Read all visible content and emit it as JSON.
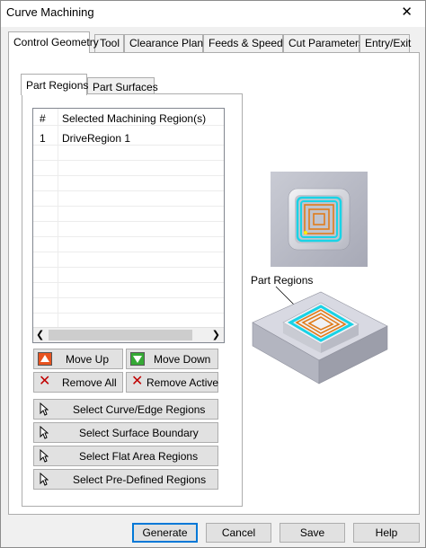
{
  "window": {
    "title": "Curve Machining",
    "close_symbol": "✕"
  },
  "tabs": [
    {
      "label": "Control Geometry",
      "active": true
    },
    {
      "label": "Tool",
      "active": false
    },
    {
      "label": "Clearance Plane",
      "active": false
    },
    {
      "label": "Feeds & Speeds",
      "active": false
    },
    {
      "label": "Cut Parameters",
      "active": false
    },
    {
      "label": "Entry/Exit",
      "active": false
    }
  ],
  "subtabs": [
    {
      "label": "Part Regions",
      "active": true
    },
    {
      "label": "Part Surfaces",
      "active": false
    }
  ],
  "region_list": {
    "columns": [
      "#",
      "Selected Machining Region(s)"
    ],
    "rows": [
      {
        "num": "1",
        "name": "DriveRegion 1"
      }
    ]
  },
  "buttons": {
    "move_up": "Move Up",
    "move_down": "Move Down",
    "remove_all": "Remove All",
    "remove_active": "Remove Active",
    "select_curve_edge": "Select Curve/Edge Regions",
    "select_surface_boundary": "Select Surface Boundary",
    "select_flat_area": "Select Flat Area Regions",
    "select_predefined": "Select Pre-Defined Regions"
  },
  "preview": {
    "label": "Part Regions"
  },
  "footer": {
    "generate": "Generate",
    "cancel": "Cancel",
    "save": "Save",
    "help": "Help"
  },
  "colors": {
    "move_up_icon": "#e8531f",
    "move_down_icon": "#35a935",
    "remove_icon": "#c00000",
    "toolpath_cyan": "#19d3e6",
    "toolpath_orange": "#e07c1b",
    "focus_blue": "#0078d7"
  }
}
